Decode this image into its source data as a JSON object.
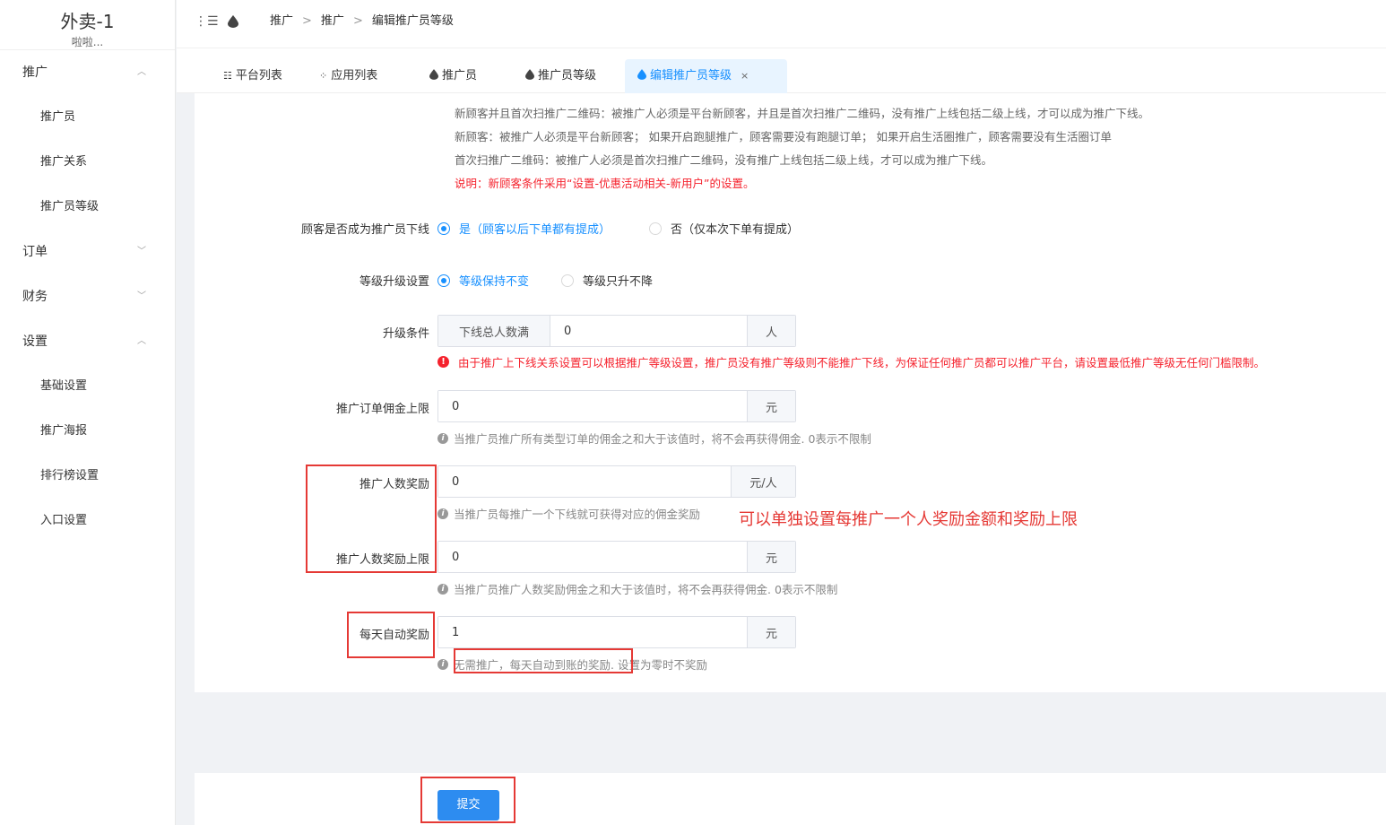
{
  "sidebar": {
    "app_title": "外卖-1",
    "app_subtitle": "啦啦...",
    "groups": [
      {
        "label": "推广",
        "arrow": "︿",
        "items": [
          "推广员",
          "推广关系",
          "推广员等级"
        ]
      },
      {
        "label": "订单",
        "arrow": "﹀",
        "items": []
      },
      {
        "label": "财务",
        "arrow": "﹀",
        "items": []
      },
      {
        "label": "设置",
        "arrow": "︿",
        "items": [
          "基础设置",
          "推广海报",
          "排行榜设置",
          "入口设置"
        ]
      }
    ]
  },
  "breadcrumb": [
    "推广",
    "推广",
    "编辑推广员等级"
  ],
  "breadcrumb_sep": ">",
  "tabs": [
    {
      "label": "平台列表",
      "icon": "list-icon"
    },
    {
      "label": "应用列表",
      "icon": "apps-icon"
    },
    {
      "label": "推广员",
      "icon": "drop-icon"
    },
    {
      "label": "推广员等级",
      "icon": "drop-icon"
    },
    {
      "label": "编辑推广员等级",
      "icon": "drop-icon",
      "active": true,
      "close": "×"
    }
  ],
  "notes": {
    "line1": "新顾客并且首次扫推广二维码：被推广人必须是平台新顾客，并且是首次扫推广二维码，没有推广上线包括二级上线，才可以成为推广下线。",
    "line2": "新顾客：被推广人必须是平台新顾客； 如果开启跑腿推广，顾客需要没有跑腿订单； 如果开启生活圈推广，顾客需要没有生活圈订单",
    "line3": "首次扫推广二维码：被推广人必须是首次扫推广二维码，没有推广上线包括二级上线，才可以成为推广下线。",
    "line4": "说明：新顾客条件采用“设置-优惠活动相关-新用户”的设置。"
  },
  "form": {
    "downline": {
      "label": "顾客是否成为推广员下线",
      "opt_yes": "是（顾客以后下单都有提成）",
      "opt_no": "否（仅本次下单有提成）"
    },
    "upgrade_setting": {
      "label": "等级升级设置",
      "opt_keep": "等级保持不变",
      "opt_up": "等级只升不降"
    },
    "upgrade_condition": {
      "label": "升级条件",
      "prefix": "下线总人数满",
      "value": "0",
      "suffix": "人",
      "warning": "由于推广上下线关系设置可以根据推广等级设置，推广员没有推广等级则不能推广下线，为保证任何推广员都可以推广平台，请设置最低推广等级无任何门槛限制。"
    },
    "commission_cap": {
      "label": "推广订单佣金上限",
      "value": "0",
      "suffix": "元",
      "help": "当推广员推广所有类型订单的佣金之和大于该值时，将不会再获得佣金. 0表示不限制"
    },
    "per_person_reward": {
      "label": "推广人数奖励",
      "value": "0",
      "suffix": "元/人",
      "help": "当推广员每推广一个下线就可获得对应的佣金奖励"
    },
    "per_person_cap": {
      "label": "推广人数奖励上限",
      "value": "0",
      "suffix": "元",
      "help": "当推广员推广人数奖励佣金之和大于该值时，将不会再获得佣金. 0表示不限制"
    },
    "daily_reward": {
      "label": "每天自动奖励",
      "value": "1",
      "suffix": "元",
      "help": "无需推广，每天自动到账的奖励. 设置为零时不奖励"
    }
  },
  "annotation_text": "可以单独设置每推广一个人奖励金额和奖励上限",
  "submit_label": "提交",
  "colors": {
    "primary": "#1890ff",
    "danger": "#f5222d",
    "button": "#2d8cf0"
  }
}
